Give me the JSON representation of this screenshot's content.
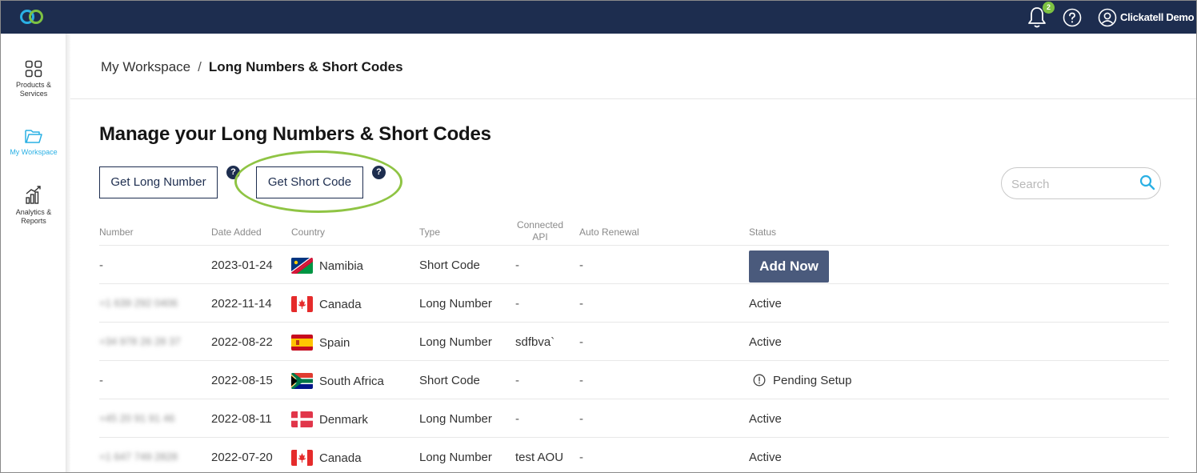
{
  "topbar": {
    "notification_count": "2",
    "user_name": "Clickatell Demo"
  },
  "sidebar": {
    "items": [
      {
        "label": "Products & Services",
        "icon": "grid-icon"
      },
      {
        "label": "My Workspace",
        "icon": "folder-icon",
        "active": true
      },
      {
        "label": "Analytics & Reports",
        "icon": "chart-icon"
      }
    ]
  },
  "breadcrumb": {
    "parent": "My Workspace",
    "separator": "/",
    "current": "Long Numbers & Short Codes"
  },
  "page": {
    "title": "Manage your Long Numbers & Short Codes",
    "get_long_number": "Get Long Number",
    "get_short_code": "Get Short Code",
    "help_glyph": "?",
    "search_placeholder": "Search"
  },
  "table": {
    "columns": [
      "Number",
      "Date Added",
      "Country",
      "Type",
      "Connected API",
      "Auto Renewal",
      "Status"
    ],
    "rows": [
      {
        "number": "-",
        "date": "2023-01-24",
        "country": "Namibia",
        "flag": "namibia",
        "type": "Short Code",
        "api": "-",
        "renewal": "-",
        "status": "Add Now",
        "status_kind": "button"
      },
      {
        "number": "+1 639 292 0406",
        "date": "2022-11-14",
        "country": "Canada",
        "flag": "canada",
        "type": "Long Number",
        "api": "-",
        "renewal": "-",
        "status": "Active",
        "status_kind": "text"
      },
      {
        "number": "+34 978 26 28 37",
        "date": "2022-08-22",
        "country": "Spain",
        "flag": "spain",
        "type": "Long Number",
        "api": "sdfbva`",
        "renewal": "-",
        "status": "Active",
        "status_kind": "text"
      },
      {
        "number": "-",
        "date": "2022-08-15",
        "country": "South Africa",
        "flag": "south-africa",
        "type": "Short Code",
        "api": "-",
        "renewal": "-",
        "status": "Pending Setup",
        "status_kind": "pending"
      },
      {
        "number": "+45 20 91 91 46",
        "date": "2022-08-11",
        "country": "Denmark",
        "flag": "denmark",
        "type": "Long Number",
        "api": "-",
        "renewal": "-",
        "status": "Active",
        "status_kind": "text"
      },
      {
        "number": "+1 647 749 2828",
        "date": "2022-07-20",
        "country": "Canada",
        "flag": "canada",
        "type": "Long Number",
        "api": "test AOU",
        "renewal": "-",
        "status": "Active",
        "status_kind": "text"
      }
    ]
  },
  "colors": {
    "navy": "#1d2d4f",
    "accent_green": "#8fc444",
    "active_blue": "#2ab0e4",
    "add_now_bg": "#4a5a7c"
  }
}
